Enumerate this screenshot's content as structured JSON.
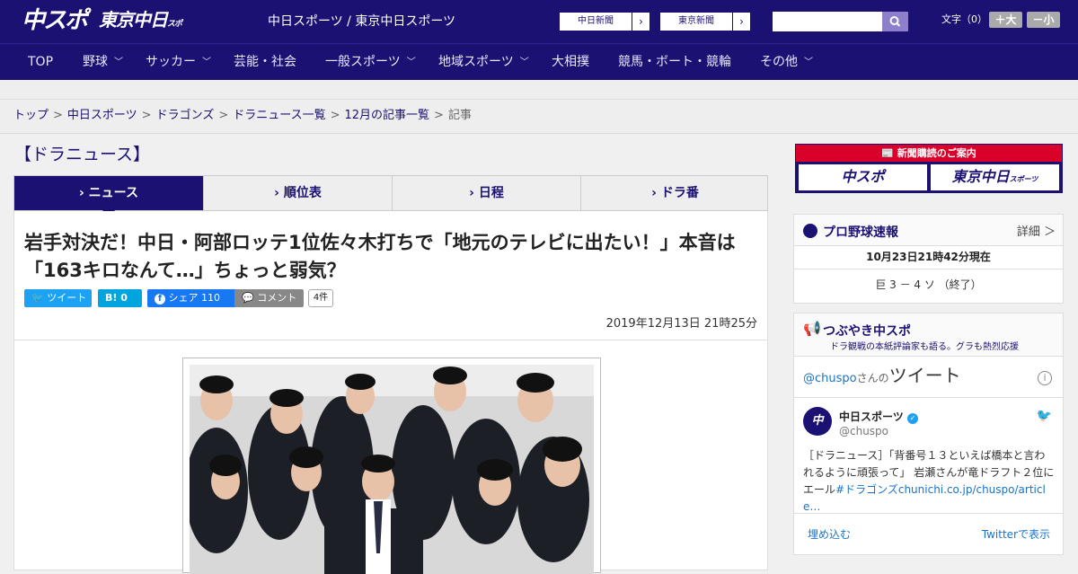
{
  "header": {
    "logo_main": "中スポ",
    "logo_sub": "東京中日",
    "logo_sub_small": "スポーツ",
    "site_title": "中日スポーツ / 東京中日スポーツ",
    "ext_links": [
      "中日新聞",
      "東京新聞"
    ],
    "font_label": "文字（0）",
    "font_larger": "＋大",
    "font_smaller": "－小"
  },
  "nav": {
    "items": [
      {
        "label": "TOP",
        "dropdown": false
      },
      {
        "label": "野球",
        "dropdown": true
      },
      {
        "label": "サッカー",
        "dropdown": true
      },
      {
        "label": "芸能・社会",
        "dropdown": false
      },
      {
        "label": "一般スポーツ",
        "dropdown": true
      },
      {
        "label": "地域スポーツ",
        "dropdown": true
      },
      {
        "label": "大相撲",
        "dropdown": false
      },
      {
        "label": "競馬・ボート・競輪",
        "dropdown": false
      },
      {
        "label": "その他",
        "dropdown": true
      }
    ]
  },
  "breadcrumb": {
    "links": [
      "トップ",
      "中日スポーツ",
      "ドラゴンズ",
      "ドラニュース一覧",
      "12月の記事一覧"
    ],
    "current": "記事"
  },
  "section_title": "【ドラニュース】",
  "tabs": [
    "ニュース",
    "順位表",
    "日程",
    "ドラ番"
  ],
  "article": {
    "headline": "岩手対決だ！中日・阿部ロッテ1位佐々木打ちで「地元のテレビに出たい！」本音は「163キロなんて…」ちょっと弱気？",
    "share": {
      "tweet": "ツイート",
      "hatena": "0",
      "fb": "シェア",
      "fb_count": "110",
      "comment": "コメント",
      "comment_count": "4件"
    },
    "date": "2019年12月13日 21時25分"
  },
  "sidebar": {
    "subscribe_title": "新聞購読のご案内",
    "subscribe_btns": [
      "中スポ",
      "東京中日"
    ],
    "subscribe_btn_small": "スポーツ",
    "baseball": {
      "title": "プロ野球速報",
      "detail": "詳細 ＞",
      "time": "10月23日21時42分現在",
      "score": "巨 3 － 4 ソ （終了）"
    },
    "tweets": {
      "title": "つぶやき中スポ",
      "subtitle": "ドラ観戦の本紙評論家も語る。グラも熱烈応援",
      "handle_prefix": "@chuspo",
      "handle_mid": "さんの",
      "handle_suffix": "ツイート",
      "account_name": "中日スポーツ",
      "account_handle": "@chuspo",
      "tweet_text": "［ドラニュース］「背番号１３といえば橋本と言われるように頑張って」 岩瀬さんが竜ドラフト２位にエール",
      "tweet_hashtag": "#ドラゴンズ",
      "tweet_link": "chunichi.co.jp/chuspo/article…",
      "embed": "埋め込む",
      "view_on_twitter": "Twitterで表示"
    }
  }
}
